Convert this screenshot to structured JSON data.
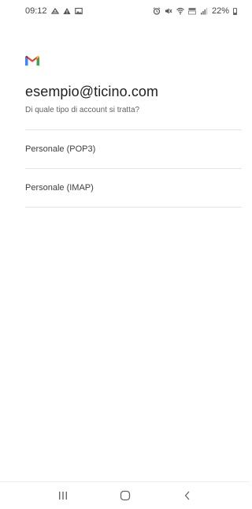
{
  "status_bar": {
    "time": "09:12",
    "battery_text": "22%",
    "battery_level": 0.22,
    "left_icons": [
      "notification-app-icon",
      "warning-icon",
      "image-icon"
    ],
    "right_icons": [
      "alarm-icon",
      "mute-icon",
      "wifi-icon",
      "volte-icon",
      "signal-icon",
      "battery-icon"
    ]
  },
  "app": {
    "logo": "gmail-icon",
    "brand_colors": {
      "red": "#EA4335",
      "blue": "#4285F4",
      "yellow": "#FBBC04",
      "green": "#34A853"
    }
  },
  "account": {
    "email": "esempio@ticino.com",
    "question": "Di quale tipo di account si tratta?"
  },
  "options": [
    {
      "label": "Personale (POP3)"
    },
    {
      "label": "Personale (IMAP)"
    }
  ],
  "nav_bar": {
    "buttons": [
      "recent-apps-icon",
      "home-icon",
      "back-icon"
    ]
  }
}
